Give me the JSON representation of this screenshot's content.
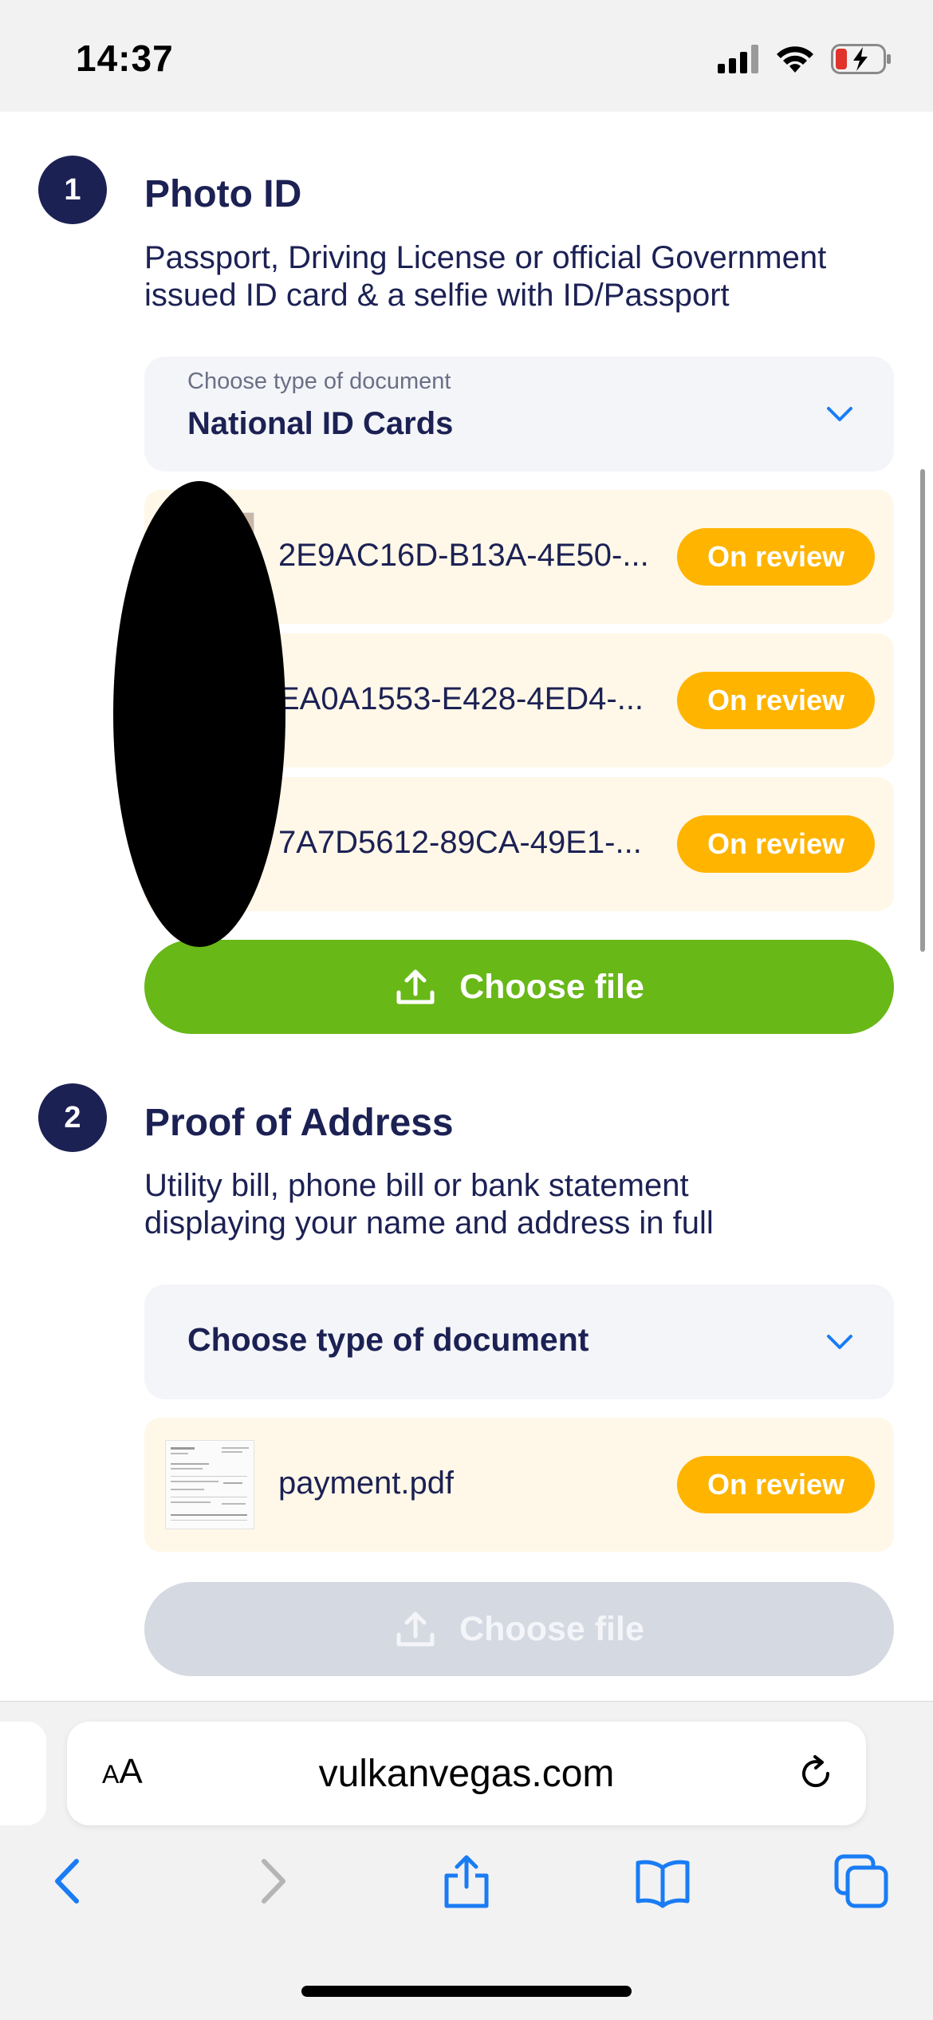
{
  "status_bar": {
    "time": "14:37"
  },
  "photo_id": {
    "step": "1",
    "title": "Photo ID",
    "description_line1": "Passport, Driving License or official Government",
    "description_line2": "issued ID card & a selfie with ID/Passport",
    "select_label": "Choose type of document",
    "select_value": "National ID Cards",
    "files": [
      {
        "name": "2E9AC16D-B13A-4E50-...",
        "status": "On review"
      },
      {
        "name": "EA0A1553-E428-4ED4-...",
        "status": "On review"
      },
      {
        "name": "7A7D5612-89CA-49E1-...",
        "status": "On review"
      }
    ],
    "choose_file_label": "Choose file"
  },
  "proof_of_address": {
    "step": "2",
    "title": "Proof of Address",
    "description_line1": "Utility bill, phone bill or bank statement",
    "description_line2": "displaying your name and address in full",
    "select_placeholder": "Choose type of document",
    "files": [
      {
        "name": "payment.pdf",
        "status": "On review"
      }
    ],
    "choose_file_label": "Choose file"
  },
  "browser": {
    "aa_small": "A",
    "aa_large": "A",
    "url": "vulkanvegas.com"
  },
  "colors": {
    "navy": "#1c2154",
    "status_badge": "#ffb400",
    "choose_file_active": "#68b817",
    "choose_file_disabled": "#d5d9e2",
    "file_row_bg": "#fff8e8",
    "ios_blue": "#1a7cf5"
  },
  "icons": [
    "signal-icon",
    "wifi-icon",
    "battery-charging-icon",
    "chevron-down-icon",
    "upload-icon",
    "reload-icon",
    "back-icon",
    "forward-icon",
    "share-icon",
    "bookmarks-icon",
    "tabs-icon"
  ]
}
